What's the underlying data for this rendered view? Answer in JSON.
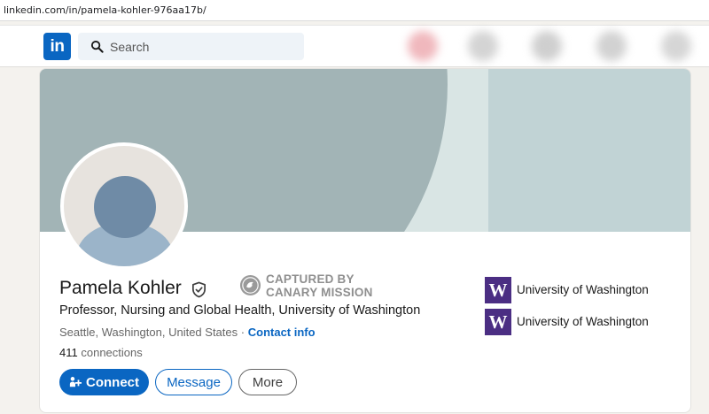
{
  "browser": {
    "url": "linkedin.com/in/pamela-kohler-976aa17b/"
  },
  "nav": {
    "logo_text": "in",
    "search_placeholder": "Search"
  },
  "profile": {
    "name": "Pamela Kohler",
    "verified_icon": "shield-check-icon",
    "stamp": {
      "line1": "CAPTURED BY",
      "line2": "CANARY MISSION"
    },
    "headline": "Professor, Nursing and Global Health, University of Washington",
    "location": "Seattle, Washington, United States",
    "separator": "·",
    "contact_info": "Contact info",
    "connections_count": "411",
    "connections_label": "connections",
    "buttons": {
      "connect": "Connect",
      "message": "Message",
      "more": "More"
    },
    "orgs": [
      {
        "logo": "W",
        "name": "University of Washington"
      },
      {
        "logo": "W",
        "name": "University of Washington"
      }
    ]
  },
  "colors": {
    "brand": "#0a66c2",
    "uw_purple": "#4b2e83",
    "banner": "#a2b4b6"
  }
}
